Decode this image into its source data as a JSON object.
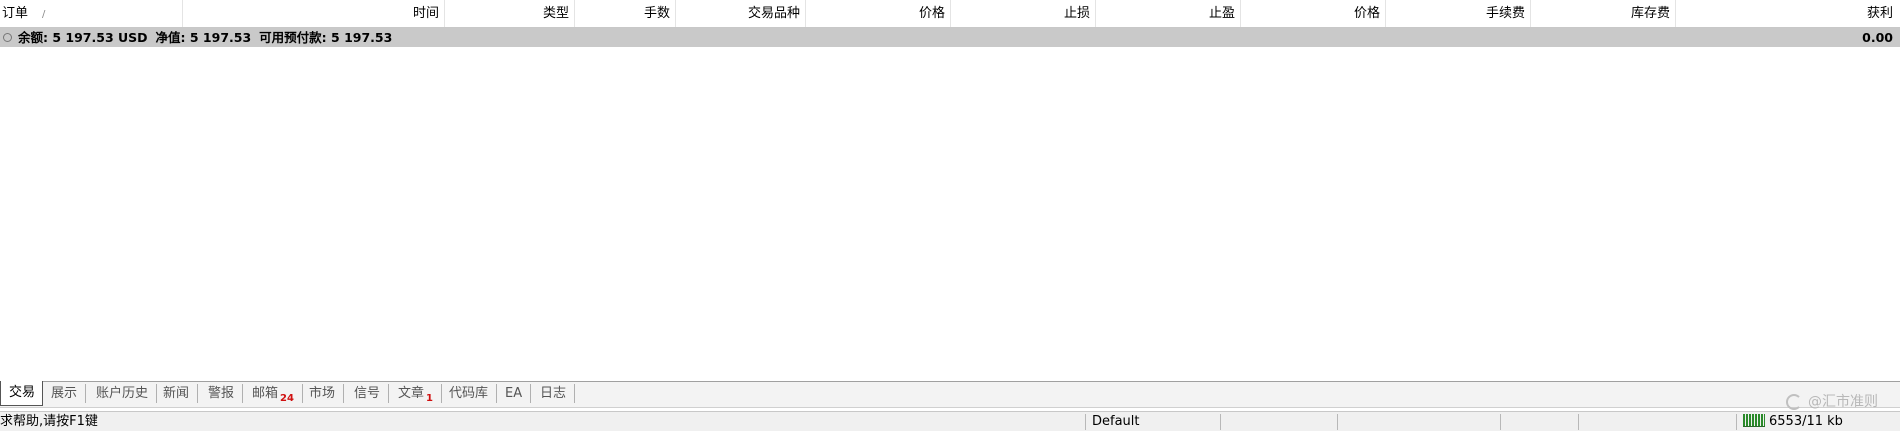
{
  "table": {
    "columns": [
      "订单",
      "时间",
      "类型",
      "手数",
      "交易品种",
      "价格",
      "止损",
      "止盈",
      "价格",
      "手续费",
      "库存费",
      "获利"
    ],
    "sort_indicator": "/"
  },
  "summary": {
    "balance": "余额: 5 197.53 USD",
    "equity": "净值: 5 197.53",
    "free_margin": "可用预付款: 5 197.53",
    "profit": "0.00"
  },
  "tabs": [
    {
      "label": "交易",
      "active": true
    },
    {
      "label": "展示"
    },
    {
      "label": "账户历史"
    },
    {
      "label": "新闻"
    },
    {
      "label": "警报"
    },
    {
      "label": "邮箱",
      "badge": "24"
    },
    {
      "label": "市场"
    },
    {
      "label": "信号"
    },
    {
      "label": "文章",
      "badge": "1"
    },
    {
      "label": "代码库"
    },
    {
      "label": "EA"
    },
    {
      "label": "日志"
    }
  ],
  "watermark": "@汇市准则",
  "status": {
    "help": "求帮助,请按F1键",
    "profile": "Default",
    "connection": "6553/11 kb"
  },
  "colors": {
    "summary_bg": "#c9c9c9",
    "badge": "#d01010",
    "connection_bars": "#2a8a2a"
  },
  "icons": {
    "summary_bullet": "circle-bullet-icon",
    "watermark_logo": "weibo-logo-icon",
    "connection": "connection-bars-icon"
  }
}
